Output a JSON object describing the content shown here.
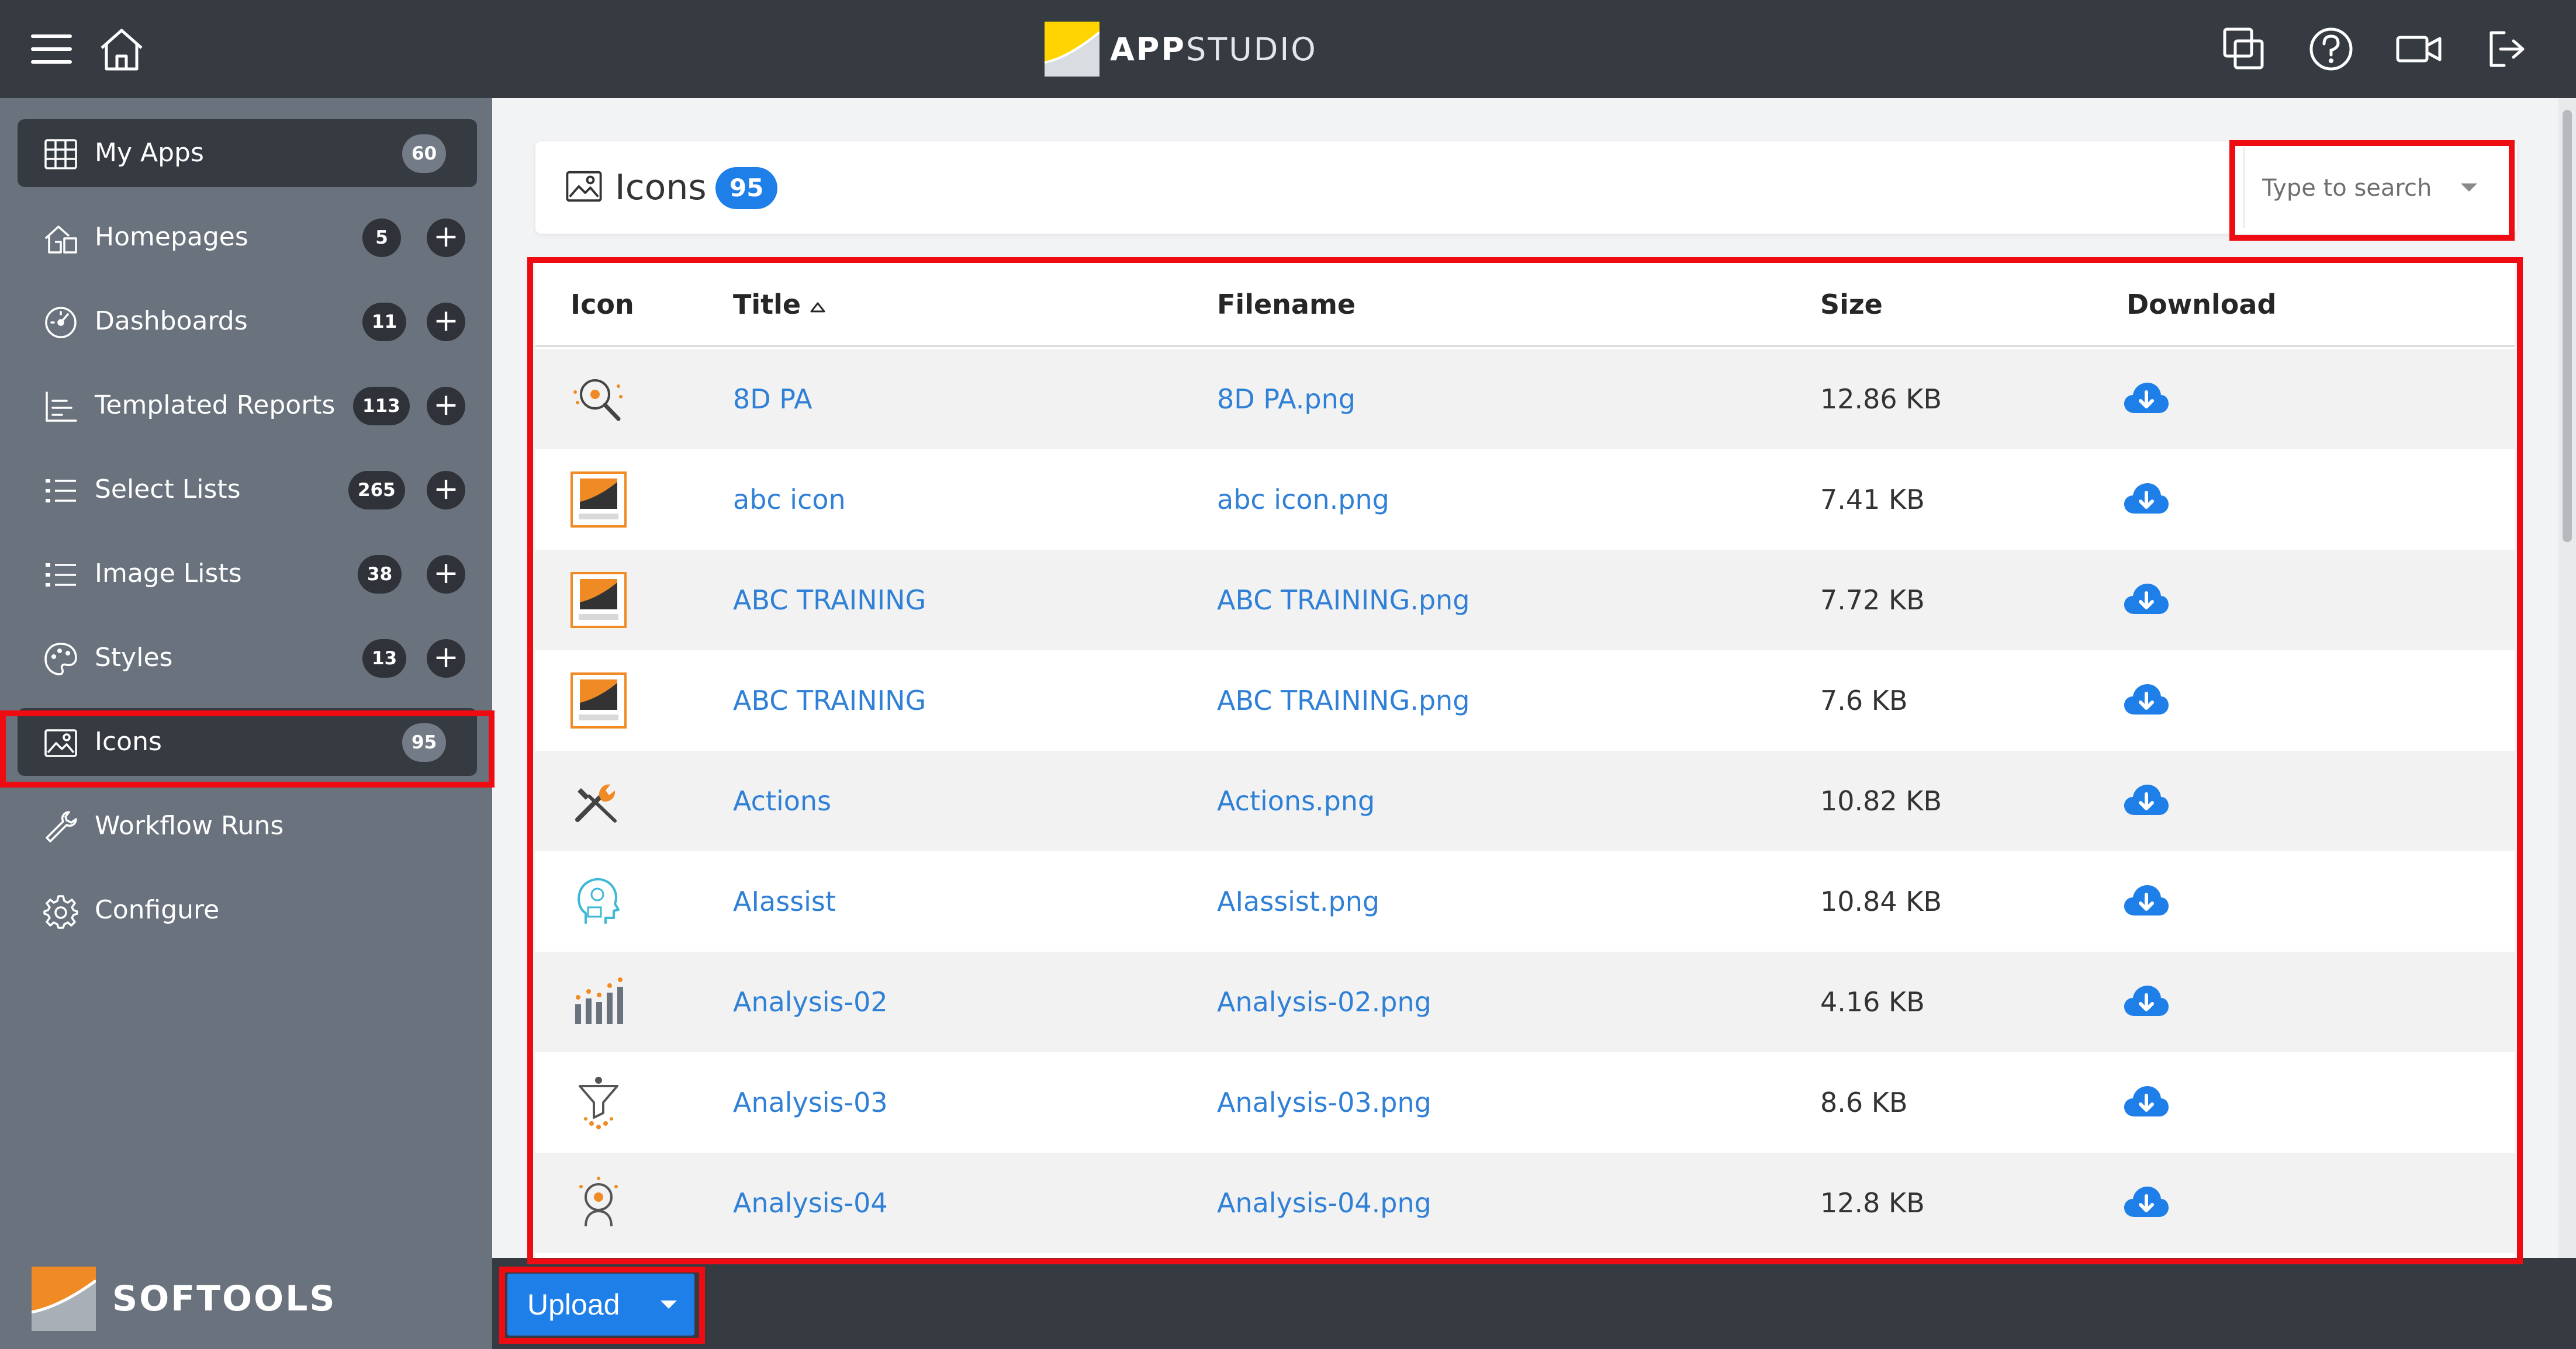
{
  "app": {
    "brand_bold": "APP",
    "brand_light": "STUDIO",
    "colors": {
      "topbar": "#363b42",
      "sidebar": "#6a727d",
      "accent": "#1f7fe8",
      "link": "#2f80d6",
      "highlight": "#ee0b12"
    }
  },
  "topbar": {
    "left_icons": [
      "hamburger-menu-icon",
      "home-icon"
    ],
    "right_icons": [
      "windows-icon",
      "help-icon",
      "video-icon",
      "logout-icon"
    ]
  },
  "sidebar": {
    "items": [
      {
        "label": "My Apps",
        "count": "60",
        "icon": "grid-icon",
        "active": true,
        "addable": false
      },
      {
        "label": "Homepages",
        "count": "5",
        "icon": "homepage-icon",
        "active": false,
        "addable": true
      },
      {
        "label": "Dashboards",
        "count": "11",
        "icon": "dashboard-icon",
        "active": false,
        "addable": true
      },
      {
        "label": "Templated Reports",
        "count": "113",
        "icon": "report-icon",
        "active": false,
        "addable": true
      },
      {
        "label": "Select Lists",
        "count": "265",
        "icon": "list-icon",
        "active": false,
        "addable": true
      },
      {
        "label": "Image Lists",
        "count": "38",
        "icon": "image-list-icon",
        "active": false,
        "addable": true
      },
      {
        "label": "Styles",
        "count": "13",
        "icon": "palette-icon",
        "active": false,
        "addable": true
      },
      {
        "label": "Icons",
        "count": "95",
        "icon": "image-icon",
        "active": true,
        "addable": false
      },
      {
        "label": "Workflow Runs",
        "count": "",
        "icon": "wrench-icon",
        "active": false,
        "addable": false
      },
      {
        "label": "Configure",
        "count": "",
        "icon": "gear-icon",
        "active": false,
        "addable": false
      }
    ],
    "add_symbol": "+",
    "footer_logo": "SOFTOOLS"
  },
  "header": {
    "title": "Icons",
    "count": "95"
  },
  "search": {
    "placeholder": "Type to search"
  },
  "table": {
    "columns": [
      "Icon",
      "Title",
      "Filename",
      "Size",
      "Download"
    ],
    "sorted_by": "Title",
    "sort_direction": "ascending",
    "rows": [
      {
        "icon": "magnifier-icon",
        "title": "8D PA",
        "filename": "8D PA.png",
        "size": "12.86 KB"
      },
      {
        "icon": "abc-training-logo-icon",
        "title": "abc icon",
        "filename": "abc icon.png",
        "size": "7.41 KB"
      },
      {
        "icon": "abc-training-logo-icon",
        "title": "ABC TRAINING",
        "filename": "ABC TRAINING.png",
        "size": "7.72 KB"
      },
      {
        "icon": "abc-training-logo-icon",
        "title": "ABC TRAINING",
        "filename": "ABC TRAINING.png",
        "size": "7.6 KB"
      },
      {
        "icon": "tools-icon",
        "title": "Actions",
        "filename": "Actions.png",
        "size": "10.82 KB"
      },
      {
        "icon": "ai-head-icon",
        "title": "AIassist",
        "filename": "AIassist.png",
        "size": "10.84 KB"
      },
      {
        "icon": "bar-analysis-icon",
        "title": "Analysis-02",
        "filename": "Analysis-02.png",
        "size": "4.16 KB"
      },
      {
        "icon": "funnel-icon",
        "title": "Analysis-03",
        "filename": "Analysis-03.png",
        "size": "8.6 KB"
      },
      {
        "icon": "person-target-icon",
        "title": "Analysis-04",
        "filename": "Analysis-04.png",
        "size": "12.8 KB"
      }
    ]
  },
  "footer": {
    "upload_label": "Upload"
  }
}
